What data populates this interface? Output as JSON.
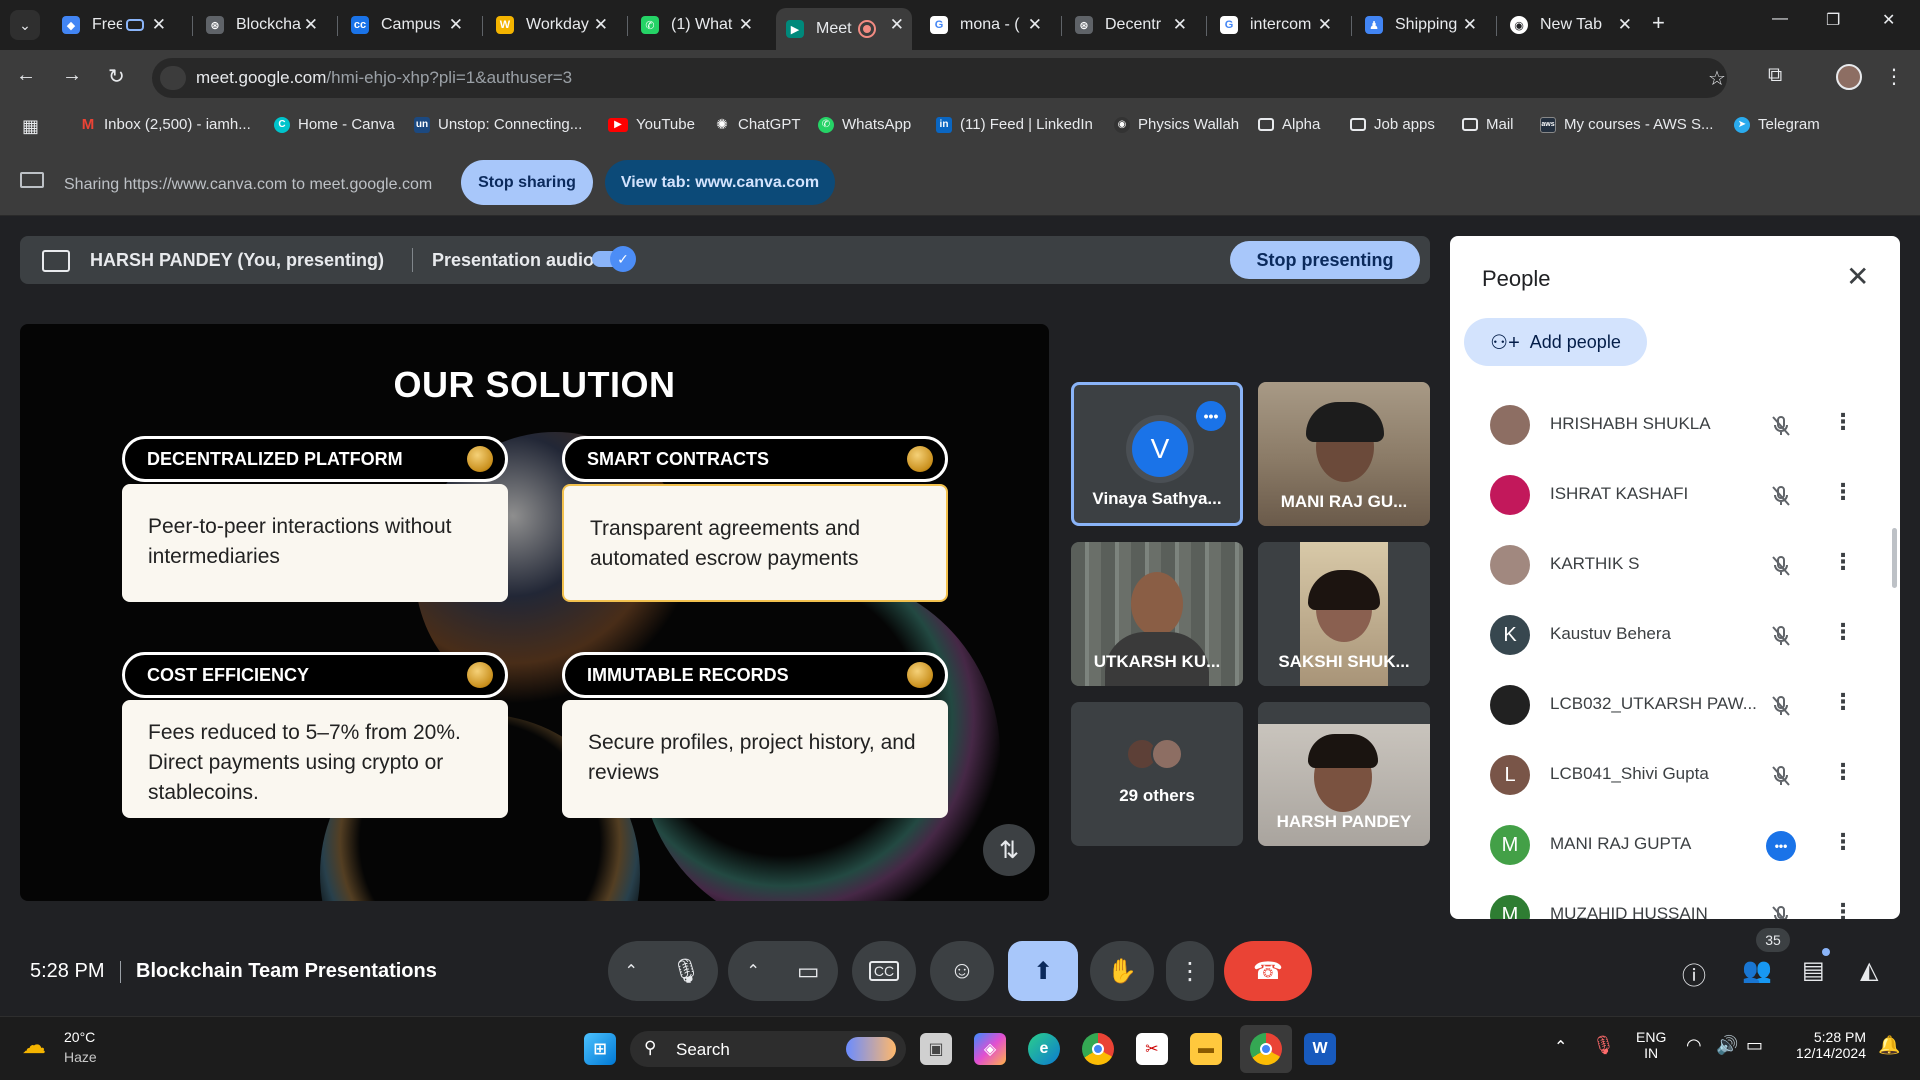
{
  "browser": {
    "tabs": [
      {
        "label": "Freel",
        "color": "#4285f4"
      },
      {
        "label": "Blockcha",
        "color": "#5f6368"
      },
      {
        "label": "Campus",
        "color": "#1a73e8"
      },
      {
        "label": "Workday",
        "color": "#f4b400"
      },
      {
        "label": "(1) What",
        "color": "#25d366"
      },
      {
        "label": "Meet",
        "color": "#00897b"
      },
      {
        "label": "mona - (",
        "color": "#ffffff"
      },
      {
        "label": "Decentr",
        "color": "#5f6368"
      },
      {
        "label": "intercom",
        "color": "#ffffff"
      },
      {
        "label": "Shipping",
        "color": "#4285f4"
      },
      {
        "label": "New Tab",
        "color": "#ffffff"
      }
    ],
    "url_domain": "meet.google.com",
    "url_path": "/hmi-ehjo-xhp?pli=1&authuser=3",
    "bookmarks": [
      {
        "label": "Inbox (2,500) - iamh...",
        "color": "#ea4335",
        "glyph": "M"
      },
      {
        "label": "Home - Canva",
        "color": "#00c4cc",
        "glyph": "C"
      },
      {
        "label": "Unstop: Connecting...",
        "color": "#1c4980",
        "glyph": "un"
      },
      {
        "label": "YouTube",
        "color": "#ff0000",
        "glyph": "▶"
      },
      {
        "label": "ChatGPT",
        "color": "#444444",
        "glyph": "✺"
      },
      {
        "label": "WhatsApp",
        "color": "#25d366",
        "glyph": "✆"
      },
      {
        "label": "(11) Feed | LinkedIn",
        "color": "#0a66c2",
        "glyph": "in"
      },
      {
        "label": "Physics Wallah",
        "color": "#333333",
        "glyph": "◉"
      },
      {
        "label": "Alpha",
        "color": "folder",
        "glyph": ""
      },
      {
        "label": "Job apps",
        "color": "folder",
        "glyph": ""
      },
      {
        "label": "Mail",
        "color": "folder",
        "glyph": ""
      },
      {
        "label": "My courses - AWS S...",
        "color": "#232f3e",
        "glyph": "aws"
      },
      {
        "label": "Telegram",
        "color": "#2aabee",
        "glyph": "➤"
      }
    ]
  },
  "sharing": {
    "text": "Sharing https://www.canva.com to meet.google.com",
    "stop_label": "Stop sharing",
    "view_label": "View tab: www.canva.com"
  },
  "presenting": {
    "name": "HARSH PANDEY (You, presenting)",
    "audio_label": "Presentation audio",
    "stop_label": "Stop presenting"
  },
  "slide": {
    "title": "OUR SOLUTION",
    "cards": [
      {
        "heading": "DECENTRALIZED PLATFORM",
        "body": "Peer-to-peer interactions without intermediaries"
      },
      {
        "heading": "SMART CONTRACTS",
        "body": "Transparent agreements and automated escrow payments"
      },
      {
        "heading": "COST EFFICIENCY",
        "body": "Fees reduced to 5–7% from 20%. Direct payments using crypto or stablecoins."
      },
      {
        "heading": "IMMUTABLE RECORDS",
        "body": "Secure profiles, project history, and reviews"
      }
    ]
  },
  "tiles": {
    "t1": {
      "name": "Vinaya Sathya...",
      "initial": "V"
    },
    "t2": {
      "name": "MANI RAJ GU..."
    },
    "t3": {
      "name": "UTKARSH KU..."
    },
    "t4": {
      "name": "SAKSHI SHUK..."
    },
    "t5": {
      "name": "29 others"
    },
    "t6": {
      "name": "HARSH PANDEY"
    }
  },
  "people": {
    "title": "People",
    "add_label": "Add people",
    "list": [
      {
        "name": "HRISHABH SHUKLA",
        "initial": "",
        "color": "#8d6e63",
        "status": "muted"
      },
      {
        "name": "ISHRAT KASHAFI",
        "initial": "",
        "color": "#c2185b",
        "status": "muted"
      },
      {
        "name": "KARTHIK S",
        "initial": "",
        "color": "#a1887f",
        "status": "muted"
      },
      {
        "name": "Kaustuv Behera",
        "initial": "K",
        "color": "#37474f",
        "status": "muted"
      },
      {
        "name": "LCB032_UTKARSH PAW...",
        "initial": "",
        "color": "#212121",
        "status": "muted"
      },
      {
        "name": "LCB041_Shivi Gupta",
        "initial": "L",
        "color": "#795548",
        "status": "muted"
      },
      {
        "name": "MANI RAJ GUPTA",
        "initial": "M",
        "color": "#43a047",
        "status": "more"
      },
      {
        "name": "MUZAHID HUSSAIN",
        "initial": "M",
        "color": "#2e7d32",
        "status": "muted"
      }
    ]
  },
  "meeting": {
    "time": "5:28 PM",
    "title": "Blockchain Team Presentations",
    "participant_count": "35"
  },
  "taskbar": {
    "weather_temp": "20°C",
    "weather_desc": "Haze",
    "search_label": "Search",
    "lang_top": "ENG",
    "lang_bottom": "IN",
    "clock_time": "5:28 PM",
    "clock_date": "12/14/2024"
  }
}
